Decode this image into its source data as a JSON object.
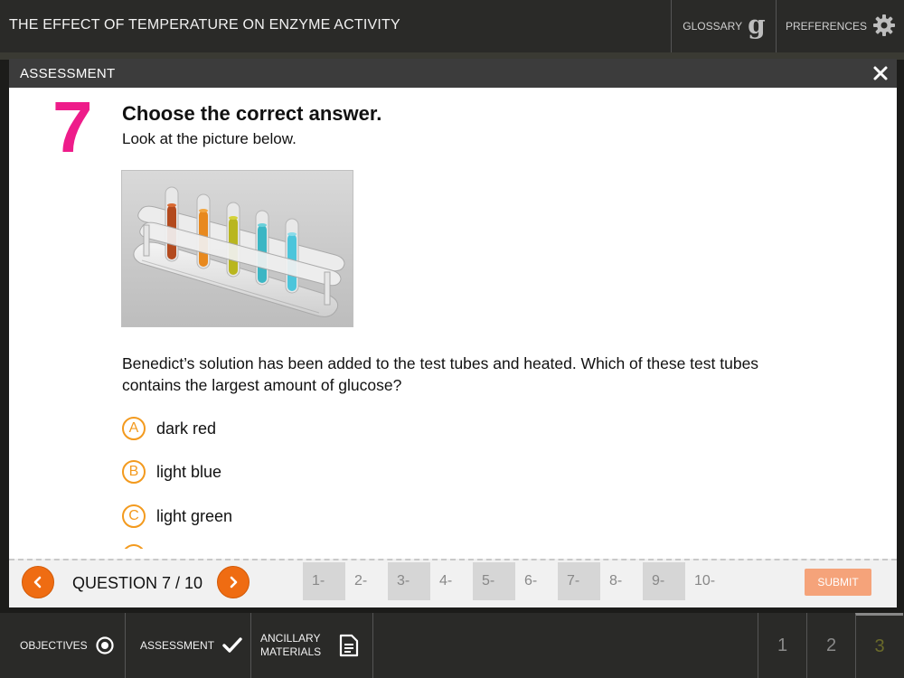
{
  "app": {
    "title": "THE EFFECT OF TEMPERATURE ON ENZYME ACTIVITY",
    "glossary_label": "GLOSSARY",
    "glossary_glyph": "g",
    "preferences_label": "PREFERENCES"
  },
  "modal": {
    "title": "ASSESSMENT",
    "close_glyph": "×"
  },
  "question": {
    "number": "7",
    "heading": "Choose the correct answer.",
    "subheading": "Look at the picture below.",
    "text": "Benedict’s solution has been added to the test tubes and heated. Which of these test tubes contains the largest amount of glucose?",
    "options": [
      {
        "letter": "A",
        "text": "dark red"
      },
      {
        "letter": "B",
        "text": "light blue"
      },
      {
        "letter": "C",
        "text": "light green"
      }
    ]
  },
  "navigation": {
    "label": "QUESTION 7 / 10",
    "tabs": [
      "1-",
      "2-",
      "3-",
      "4-",
      "5-",
      "6-",
      "7-",
      "8-",
      "9-",
      "10-"
    ],
    "submit_label": "SUBMIT"
  },
  "bottom_bar": {
    "objectives_label": "OBJECTIVES",
    "assessment_label": "ASSESSMENT",
    "ancillary_line1": "ANCILLARY",
    "ancillary_line2": "MATERIALS",
    "pages": [
      "1",
      "2",
      "3"
    ],
    "active_page": "3"
  },
  "colors": {
    "accent_orange": "#ef6c12",
    "question_number": "#ee1c8a",
    "option_ring": "#f39a1e",
    "submit_bg": "#f5a37a"
  },
  "icons": {
    "glossary": "glossary-g-icon",
    "preferences": "gear-icon",
    "close": "close-icon",
    "prev": "chevron-left-icon",
    "next": "chevron-right-icon",
    "objectives": "target-icon",
    "assessment": "checkmark-icon",
    "ancillary": "document-icon"
  }
}
